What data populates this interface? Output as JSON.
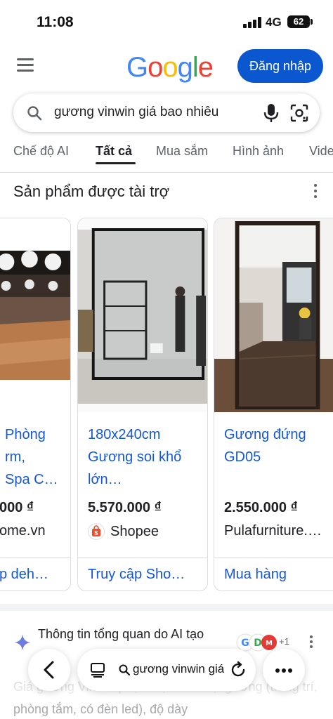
{
  "status_bar": {
    "time": "11:08",
    "network": "4G",
    "battery": "62"
  },
  "header": {
    "logo_letters": [
      {
        "char": "G",
        "color": "#4285F4"
      },
      {
        "char": "o",
        "color": "#EA4335"
      },
      {
        "char": "o",
        "color": "#FBBC05"
      },
      {
        "char": "g",
        "color": "#4285F4"
      },
      {
        "char": "l",
        "color": "#34A853"
      },
      {
        "char": "e",
        "color": "#EA4335"
      }
    ],
    "login_label": "Đăng nhập"
  },
  "search": {
    "query": "gương vinwin giá bao nhiêu"
  },
  "tabs": [
    "Chế độ AI",
    "Tất cả",
    "Mua sắm",
    "Hình ảnh",
    "Vide"
  ],
  "active_tab": "Tất cả",
  "sponsored": {
    "title": "Sản phẩm được tài trợ",
    "cards": [
      {
        "title_lines": [
          "Phòng",
          "rm,",
          "Spa C…"
        ],
        "price": "000 ₫",
        "seller": "ome.vn",
        "action": "p deh…"
      },
      {
        "title_lines": [
          "180x240cm",
          "Gương soi khổ",
          "lớn…"
        ],
        "price": "5.570.000 ₫",
        "seller": "Shopee",
        "action": "Truy cập Sho…"
      },
      {
        "title_lines": [
          "Gương đứng",
          "GD05"
        ],
        "price": "2.550.000 ₫",
        "seller": "Pulafurniture.…",
        "action": "Mua hàng"
      }
    ]
  },
  "ai_overview": {
    "title": "Thông tin tổng quan do AI tạo",
    "sources_more": "+1",
    "snippet": "Giá gương Vinwin phụ thuộc vào loại gương (trang trí, phòng tắm, có đèn led), độ dày"
  },
  "browser_bar": {
    "address": "gương vinwin giá bao nhiêu"
  },
  "colors": {
    "accent": "#0b57d0",
    "link": "#1558d6",
    "shopee": "#ee4d2d"
  }
}
